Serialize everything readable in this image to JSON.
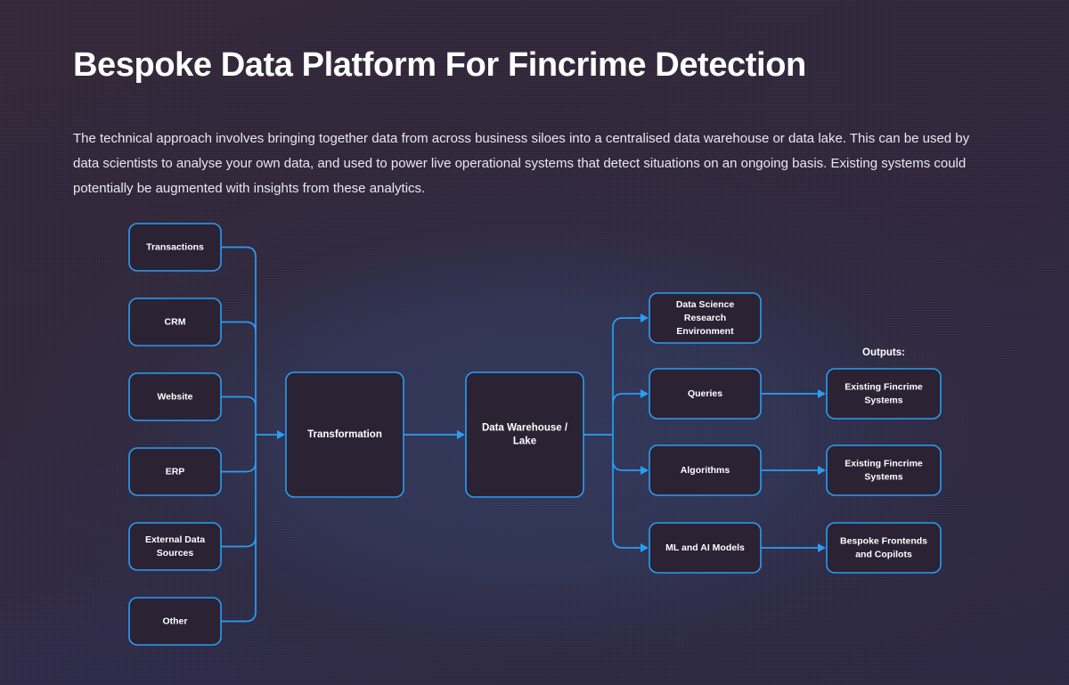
{
  "page": {
    "title": "Bespoke Data Platform For Fincrime Detection",
    "intro": "The technical approach involves bringing together data from across business siloes into a centralised data warehouse or data lake. This can be used by data scientists to analyse your own data, and used to power live operational systems that detect situations on an ongoing basis.  Existing systems could potentially be augmented with insights from these analytics."
  },
  "colors": {
    "background": "#322638",
    "canvas": "#2f3556",
    "node_border": "#2a9df4",
    "node_fill": "#2b2233",
    "connector": "#2a9df4",
    "text": "#ffffff"
  },
  "diagram": {
    "outputs_header": "Outputs:",
    "sources": [
      {
        "label": "Transactions",
        "lines": [
          "Transactions"
        ]
      },
      {
        "label": "CRM",
        "lines": [
          "CRM"
        ]
      },
      {
        "label": "Website",
        "lines": [
          "Website"
        ]
      },
      {
        "label": "ERP",
        "lines": [
          "ERP"
        ]
      },
      {
        "label": "External Data Sources",
        "lines": [
          "External Data",
          "Sources"
        ]
      },
      {
        "label": "Other",
        "lines": [
          "Other"
        ]
      }
    ],
    "stages": [
      {
        "label": "Transformation",
        "lines": [
          "Transformation"
        ]
      },
      {
        "label": "Data Warehouse / Lake",
        "lines": [
          "Data Warehouse /",
          "Lake"
        ]
      }
    ],
    "capabilities": [
      {
        "label": "Data Science Research Environment",
        "lines": [
          "Data Science",
          "Research",
          "Environment"
        ]
      },
      {
        "label": "Queries",
        "lines": [
          "Queries"
        ]
      },
      {
        "label": "Algorithms",
        "lines": [
          "Algorithms"
        ]
      },
      {
        "label": "ML and AI Models",
        "lines": [
          "ML and AI Models"
        ]
      }
    ],
    "outputs": [
      {
        "label": "Existing Fincrime Systems",
        "lines": [
          "Existing Fincrime",
          "Systems"
        ]
      },
      {
        "label": "Existing Fincrime Systems",
        "lines": [
          "Existing Fincrime",
          "Systems"
        ]
      },
      {
        "label": "Bespoke Frontends and Copilots",
        "lines": [
          "Bespoke Frontends",
          "and Copilots"
        ]
      }
    ]
  }
}
